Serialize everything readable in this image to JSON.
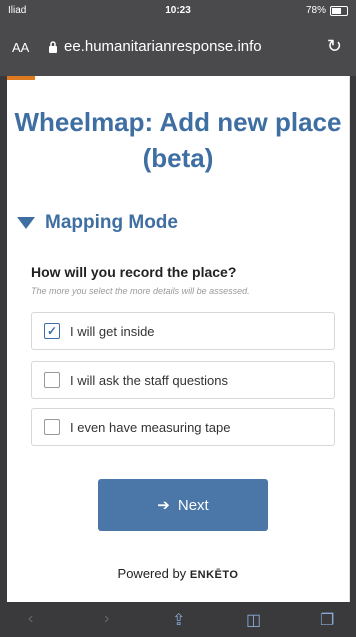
{
  "status": {
    "carrier": "Iliad",
    "time": "10:23",
    "battery": "78%",
    "battery_level": 0.78
  },
  "browser": {
    "aa_label": "AA",
    "url": "ee.humanitarianresponse.info"
  },
  "form": {
    "title": "Wheelmap: Add new place (beta)",
    "section": "Mapping Mode",
    "question": "How will you record the place?",
    "hint": "The more you select the more details will be assessed.",
    "options": [
      {
        "label": "I will get inside",
        "checked": true
      },
      {
        "label": "I will ask the staff questions",
        "checked": false
      },
      {
        "label": "I even have measuring tape",
        "checked": false
      }
    ],
    "next_label": "Next",
    "powered_by": "Powered by",
    "brand": "ENKĒTO"
  },
  "icons": {
    "back": "back-icon",
    "forward": "forward-icon",
    "share": "share-icon",
    "bookmarks": "bookmarks-icon",
    "tabs": "tabs-icon"
  },
  "colors": {
    "accent": "#3f6fa2",
    "button": "#4a76a8",
    "orange": "#e07a1f"
  }
}
